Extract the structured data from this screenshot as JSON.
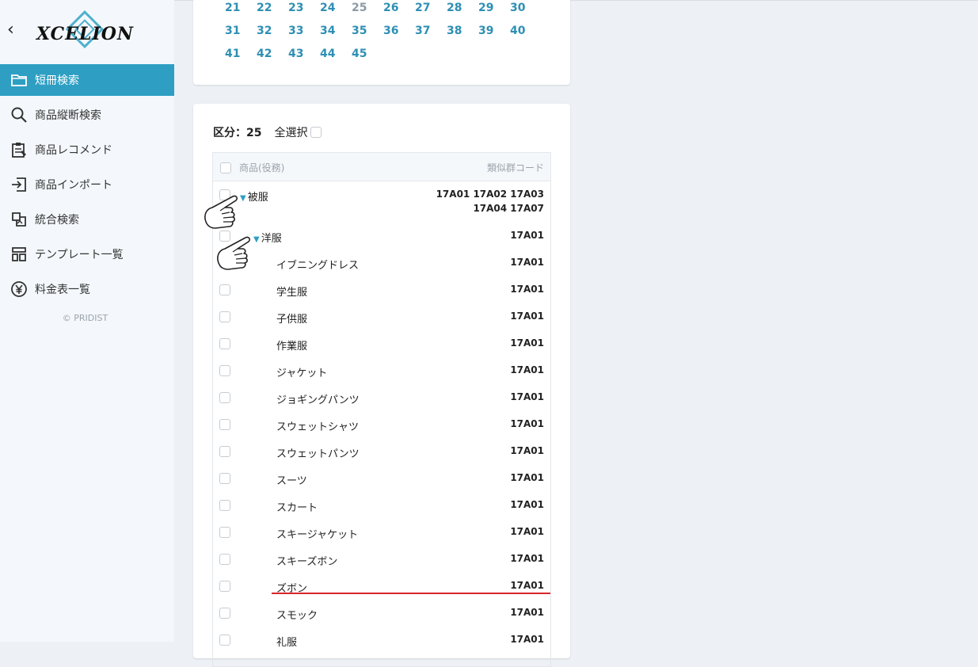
{
  "sidebar": {
    "logo_text": "XCELION",
    "items": [
      {
        "label": "短冊検索",
        "icon": "folder-icon",
        "active": true
      },
      {
        "label": "商品縦断検索",
        "icon": "search-icon",
        "active": false
      },
      {
        "label": "商品レコメンド",
        "icon": "clipboard-icon",
        "active": false
      },
      {
        "label": "商品インポート",
        "icon": "import-icon",
        "active": false
      },
      {
        "label": "統合検索",
        "icon": "merge-icon",
        "active": false
      },
      {
        "label": "テンプレート一覧",
        "icon": "template-icon",
        "active": false
      },
      {
        "label": "料金表一覧",
        "icon": "yen-icon",
        "active": false
      }
    ],
    "copyright": "© PRIDIST"
  },
  "pagination": {
    "rows": [
      [
        "21",
        "22",
        "23",
        "24",
        "25",
        "26",
        "27",
        "28",
        "29",
        "30"
      ],
      [
        "31",
        "32",
        "33",
        "34",
        "35",
        "36",
        "37",
        "38",
        "39",
        "40"
      ],
      [
        "41",
        "42",
        "43",
        "44",
        "45"
      ]
    ],
    "current": "25"
  },
  "selection": {
    "count_label": "区分：25",
    "select_all_label": "全選択"
  },
  "table": {
    "col_product": "商品(役務)",
    "col_code": "類似群コード",
    "groups": [
      {
        "name": "被服",
        "code_line1": "17A01 17A02 17A03",
        "code_line2": "17A04 17A07"
      },
      {
        "name": "洋服",
        "code": "17A01"
      }
    ],
    "items": [
      {
        "name": "イブニングドレス",
        "code": "17A01"
      },
      {
        "name": "学生服",
        "code": "17A01"
      },
      {
        "name": "子供服",
        "code": "17A01"
      },
      {
        "name": "作業服",
        "code": "17A01"
      },
      {
        "name": "ジャケット",
        "code": "17A01"
      },
      {
        "name": "ジョギングパンツ",
        "code": "17A01"
      },
      {
        "name": "スウェットシャツ",
        "code": "17A01"
      },
      {
        "name": "スウェットパンツ",
        "code": "17A01"
      },
      {
        "name": "スーツ",
        "code": "17A01"
      },
      {
        "name": "スカート",
        "code": "17A01"
      },
      {
        "name": "スキージャケット",
        "code": "17A01"
      },
      {
        "name": "スキーズボン",
        "code": "17A01"
      },
      {
        "name": "ズボン",
        "code": "17A01"
      },
      {
        "name": "スモック",
        "code": "17A01"
      },
      {
        "name": "礼服",
        "code": "17A01"
      }
    ]
  }
}
